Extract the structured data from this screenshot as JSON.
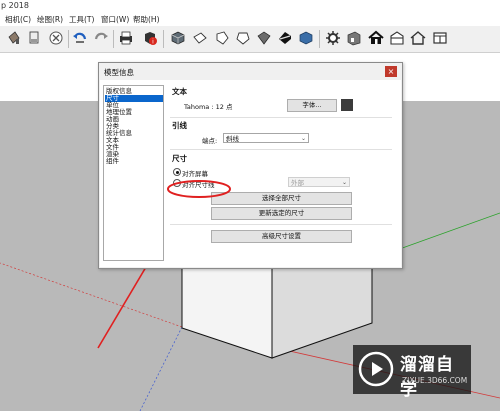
{
  "window": {
    "title_fragment": "p 2018"
  },
  "menu": [
    "相机(C)",
    "绘图(R)",
    "工具(T)",
    "窗口(W)",
    "帮助(H)"
  ],
  "toolbar": {
    "icons": [
      "paint-bucket-icon",
      "eraser-icon",
      "delete-icon",
      "undo-icon",
      "redo-icon",
      "print-icon",
      "model-info-icon",
      "iso-view-icon",
      "top-view-icon",
      "front-view-icon",
      "right-view-icon",
      "back-view-icon",
      "left-view-icon",
      "bottom-view-icon",
      "warehouse-icon",
      "get-models-icon",
      "home-icon",
      "share-icon",
      "house-outline-icon",
      "layout-icon"
    ]
  },
  "dialog": {
    "title": "模型信息",
    "close": "×",
    "categories": [
      "版权信息",
      "尺寸",
      "单位",
      "地理位置",
      "动画",
      "分类",
      "统计信息",
      "文本",
      "文件",
      "渲染",
      "组件"
    ],
    "selected_category": "尺寸",
    "text_section": {
      "heading": "文本",
      "font_desc": "Tahoma : 12 点",
      "font_button": "字体...",
      "font_color": "#3b3b3b"
    },
    "leader_section": {
      "heading": "引线",
      "endpoint_label": "端点:",
      "endpoint_value": "斜线"
    },
    "dimension_section": {
      "heading": "尺寸",
      "align_screen": "对齐屏幕",
      "align_dimension_line": "对齐尺寸线",
      "align_option": "外部",
      "select_all_button": "选择全部尺寸",
      "update_selected_button": "更新选定的尺寸",
      "advanced_button": "高级尺寸设置"
    }
  },
  "watermark": {
    "brand": "溜溜自学",
    "url": "ZIXUE.3D66.COM"
  },
  "colors": {
    "highlight_red": "#e02020",
    "selection_blue": "#0a66cc",
    "sky": "#ffffff",
    "ground": "#b9b9b9"
  }
}
